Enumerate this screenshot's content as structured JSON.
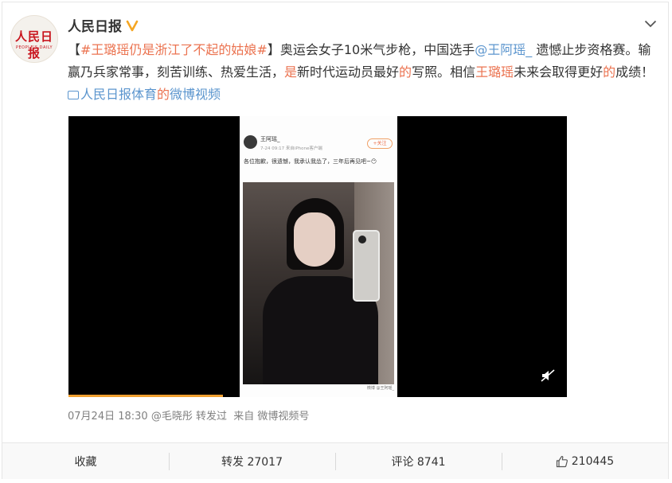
{
  "account": {
    "name": "人民日报",
    "avatar_text": "人民日报",
    "avatar_subtext": "PEOPLE'S DAILY"
  },
  "post": {
    "bracket_open": "【",
    "topic": "#王璐瑶仍是浙江了不起的姑娘#",
    "bracket_close": "】",
    "text_1": "奥运会女子10米气步枪，中国选手",
    "mention": "@王阿瑶_",
    "text_2": " 遗憾止步资格赛。输赢乃兵家常事，刻苦训练、热爱生活，",
    "word_shi": "是",
    "text_3": "新时代运动员最好",
    "word_de1": "的",
    "text_4": "写照。相信",
    "name_hl": "王璐瑶",
    "text_5": "未来会取得更好",
    "word_de2": "的",
    "text_6": "成绩！",
    "video_link_1": "人民日报体育",
    "video_link_de": "的",
    "video_link_2": "微博视频"
  },
  "video_frame": {
    "user": "王阿瑶_",
    "meta": "7-24 09:17  来自iPhone客户端",
    "follow": "+关注",
    "text": "各位抱歉，很遗憾，我承认我怂了，三年后再见吧~😶",
    "watermark": "微博 @王阿瑶_"
  },
  "video_progress": 0.31,
  "meta": {
    "time": "07月24日 18:30",
    "sep1": " ",
    "repost_by": "@毛晓彤",
    "reposted": " 转发过",
    "from_label": "  来自 ",
    "source": "微博视频号"
  },
  "actions": {
    "favorite": "收藏",
    "repost": "转发 27017",
    "comment": "评论 8741",
    "like": "210445"
  },
  "colors": {
    "link_orange": "#eb7350",
    "link_blue": "#5b95ce",
    "verify_orange": "#f5a623",
    "brand_red": "#c9151e"
  }
}
